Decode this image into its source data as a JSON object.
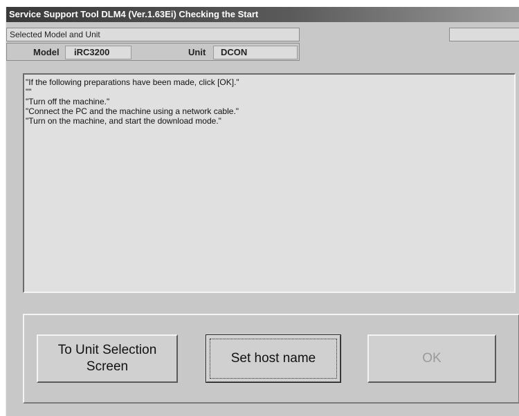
{
  "window": {
    "title": "Service Support Tool DLM4 (Ver.1.63Ei) Checking the Start"
  },
  "selection": {
    "header": "Selected Model and Unit",
    "model_label": "Model",
    "model_value": "iRC3200",
    "unit_label": "Unit",
    "unit_value": "DCON"
  },
  "messages": [
    "\"If the following preparations have been made, click [OK].\"",
    "\"\"",
    "\"Turn off the machine.\"",
    "\"Connect the PC and the machine using a network cable.\"",
    "\"Turn on the machine, and start the download mode.\""
  ],
  "buttons": {
    "unit_selection_line1": "To Unit Selection",
    "unit_selection_line2": "Screen",
    "set_host_name": "Set host name",
    "ok": "OK"
  }
}
